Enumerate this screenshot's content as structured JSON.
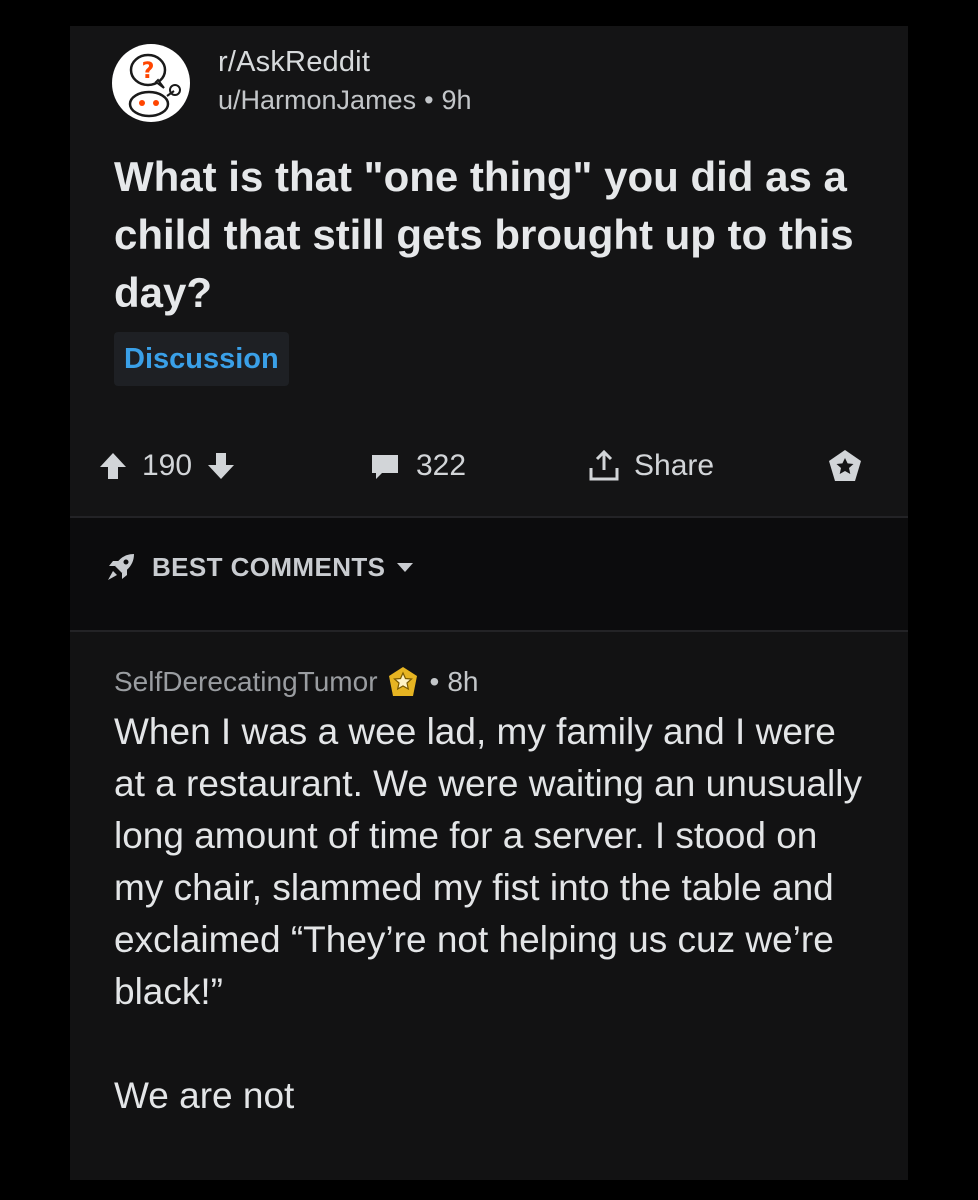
{
  "post": {
    "subreddit": "r/AskReddit",
    "author": "u/HarmonJames",
    "age": "9h",
    "title": "What is that \"one thing\" you did as a child that still gets brought up to this day?",
    "flair": "Discussion",
    "votes": "190",
    "comments": "322",
    "share_label": "Share"
  },
  "sort": {
    "label": "BEST COMMENTS"
  },
  "comment": {
    "author": "SelfDerecatingTumor",
    "age": "8h",
    "paragraphs": [
      "When I was a wee lad, my family and I were at a restaurant. We were waiting an unusually long amount of time for a server. I stood on my chair, slammed my fist into the table and exclaimed “They’re not helping us cuz we’re black!”",
      "We are not"
    ]
  },
  "colors": {
    "background": "#121213",
    "accent_flair": "#3aa0e8",
    "award_gold": "#e6b422"
  },
  "icons": [
    "subreddit-avatar-icon",
    "upvote-icon",
    "downvote-icon",
    "comment-icon",
    "share-icon",
    "save-icon",
    "rocket-icon",
    "chevron-down-icon",
    "award-icon"
  ]
}
